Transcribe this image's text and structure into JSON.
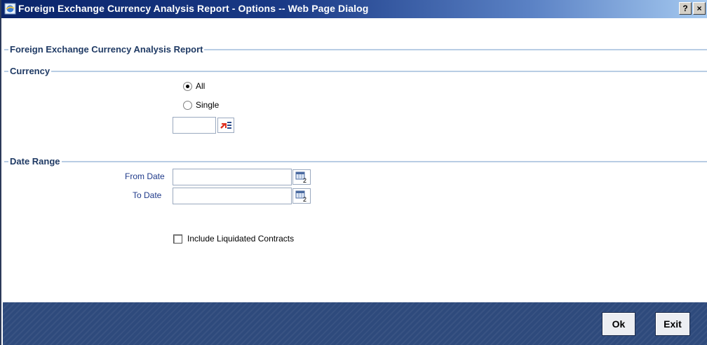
{
  "window": {
    "title": "Foreign Exchange Currency Analysis Report - Options -- Web Page Dialog",
    "help_label": "?",
    "close_label": "×"
  },
  "report_section": {
    "title": "Foreign Exchange Currency Analysis Report"
  },
  "currency_section": {
    "title": "Currency",
    "options": [
      {
        "label": "All",
        "selected": true
      },
      {
        "label": "Single",
        "selected": false
      }
    ],
    "currency_value": ""
  },
  "date_range_section": {
    "title": "Date Range",
    "from_label": "From Date",
    "from_value": "",
    "to_label": "To Date",
    "to_value": ""
  },
  "include_liquidated": {
    "label": "Include Liquidated Contracts",
    "checked": false
  },
  "footer": {
    "ok_label": "Ok",
    "exit_label": "Exit"
  },
  "colors": {
    "title_bar": "#0a246a",
    "section_title": "#1f3a64",
    "label_blue": "#1f3a8a",
    "footer_bg": "#2e4a7c"
  }
}
